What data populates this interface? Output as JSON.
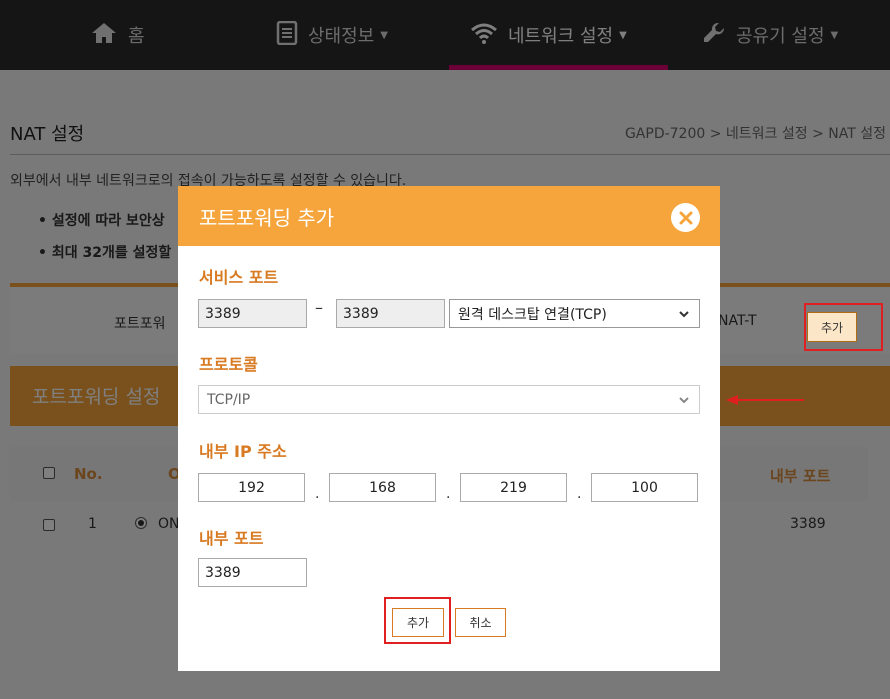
{
  "nav": {
    "items": [
      {
        "label": "홈",
        "icon": "home-icon"
      },
      {
        "label": "상태정보",
        "icon": "document-icon"
      },
      {
        "label": "네트워크 설정",
        "icon": "wifi-icon"
      },
      {
        "label": "공유기 설정",
        "icon": "wrench-icon"
      }
    ],
    "active_index": 2,
    "active_color": "#d6006e"
  },
  "page": {
    "title": "NAT 설정",
    "breadcrumb": "GAPD-7200 > 네트워크 설정 > NAT 설정",
    "description": "외부에서 내부 네트워크로의 접속이 가능하도록 설정할 수 있습니다.",
    "bullets": [
      "• 설정에 따라 보안상",
      "• 최대 32개를 설정할"
    ],
    "tabs": [
      "포트포워",
      "NAT-T"
    ],
    "section_title": "포트포워딩 설정",
    "add_button": "추가",
    "table": {
      "headers": [
        "No.",
        "O",
        "내부 포트"
      ],
      "rows": [
        {
          "no": "1",
          "state": "ON",
          "internal_port": "3389"
        }
      ]
    }
  },
  "modal": {
    "title": "포트포워딩 추가",
    "service_port_label": "서비스 포트",
    "service_port_start": "3389",
    "service_port_separator": "–",
    "service_port_end": "3389",
    "service_select": "원격 데스크탑 연결(TCP)",
    "protocol_label": "프로토콜",
    "protocol_select": "TCP/IP",
    "internal_ip_label": "내부 IP 주소",
    "ip": [
      "192",
      "168",
      "219",
      "100"
    ],
    "ip_separator": ".",
    "internal_port_label": "내부 포트",
    "internal_port": "3389",
    "add_button": "추가",
    "cancel_button": "취소",
    "header_color": "#f5a53c",
    "accent_color": "#d87a22",
    "highlight_color": "#e02020"
  }
}
